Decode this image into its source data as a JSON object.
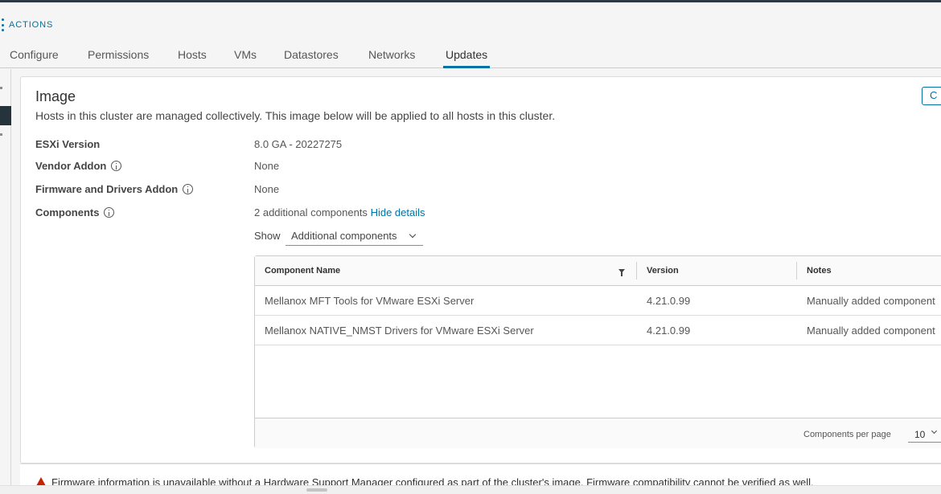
{
  "actions": {
    "label": "ACTIONS",
    "icon": "kebab-icon"
  },
  "tabs": [
    {
      "label": "Configure",
      "active": false
    },
    {
      "label": "Permissions",
      "active": false
    },
    {
      "label": "Hosts",
      "active": false
    },
    {
      "label": "VMs",
      "active": false
    },
    {
      "label": "Datastores",
      "active": false
    },
    {
      "label": "Networks",
      "active": false
    },
    {
      "label": "Updates",
      "active": true
    }
  ],
  "image": {
    "title": "Image",
    "description": "Hosts in this cluster are managed collectively. This image below will be applied to all hosts in this cluster.",
    "corner_button_label": "C",
    "properties": {
      "esxi_version": {
        "label": "ESXi Version",
        "value": "8.0 GA - 20227275"
      },
      "vendor_addon": {
        "label": "Vendor Addon",
        "value": "None"
      },
      "firmware_addon": {
        "label": "Firmware and Drivers Addon",
        "value": "None"
      },
      "components": {
        "label": "Components",
        "value": "2 additional components",
        "link": "Hide details"
      }
    },
    "show_label": "Show",
    "show_selected": "Additional components"
  },
  "grid": {
    "columns": [
      "Component Name",
      "Version",
      "Notes"
    ],
    "rows": [
      {
        "name": "Mellanox MFT Tools for VMware ESXi Server",
        "version": "4.21.0.99",
        "notes": "Manually added component"
      },
      {
        "name": "Mellanox NATIVE_NMST Drivers for VMware ESXi Server",
        "version": "4.21.0.99",
        "notes": "Manually added component"
      }
    ],
    "footer": {
      "per_page_label": "Components per page",
      "per_page_value": "10"
    }
  },
  "alert": {
    "text": "Firmware information is unavailable without a Hardware Support Manager configured as part of the cluster's image. Firmware compatibility cannot be verified as well.",
    "color": "#c92100"
  },
  "colors": {
    "accent": "#0072a3",
    "topbar": "#2c3a45",
    "warning": "#c92100"
  }
}
